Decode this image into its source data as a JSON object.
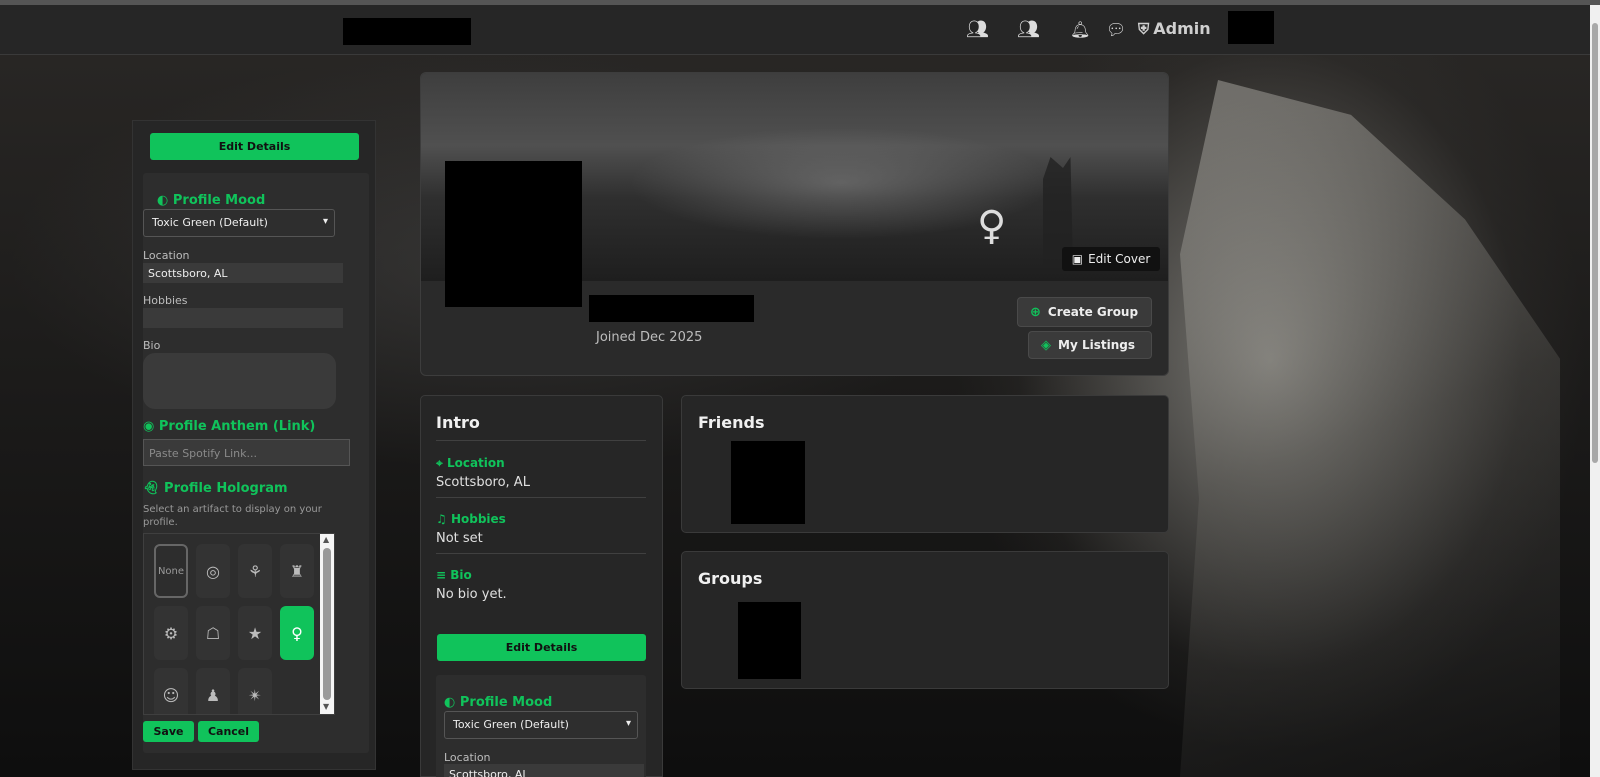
{
  "nav": {
    "friends_icon": "friends-icon",
    "groups_icon": "groups-icon",
    "bell_icon": "bell-icon",
    "chat_icon": "chat-icon",
    "admin_label": "Admin"
  },
  "edit_panel": {
    "edit_details_label": "Edit Details",
    "mood_title": "Profile Mood",
    "mood_value": "Toxic Green (Default)",
    "location_label": "Location",
    "location_value": "Scottsboro, AL",
    "hobbies_label": "Hobbies",
    "hobbies_value": "",
    "bio_label": "Bio",
    "bio_value": "",
    "anthem_title": "Profile Anthem (Link)",
    "anthem_placeholder": "Paste Spotify Link...",
    "hologram_title": "Profile Hologram",
    "hologram_desc": "Select an artifact to display on your profile.",
    "hologram_none": "None",
    "save_label": "Save",
    "cancel_label": "Cancel"
  },
  "profile": {
    "edit_cover_label": "Edit Cover",
    "joined": "Joined Dec 2025",
    "create_group_label": "Create Group",
    "my_listings_label": "My Listings"
  },
  "intro": {
    "title": "Intro",
    "location_label": "Location",
    "location_value": "Scottsboro, AL",
    "hobbies_label": "Hobbies",
    "hobbies_value": "Not set",
    "bio_label": "Bio",
    "bio_value": "No bio yet.",
    "edit_details_label": "Edit Details",
    "mood_title": "Profile Mood",
    "mood_value": "Toxic Green (Default)",
    "location_field_label": "Location",
    "location_field_value": "Scottsboro, AL"
  },
  "friends": {
    "title": "Friends"
  },
  "groups": {
    "title": "Groups"
  },
  "colors": {
    "accent": "#10c35b",
    "panel": "#262626",
    "topbar": "#262626"
  }
}
